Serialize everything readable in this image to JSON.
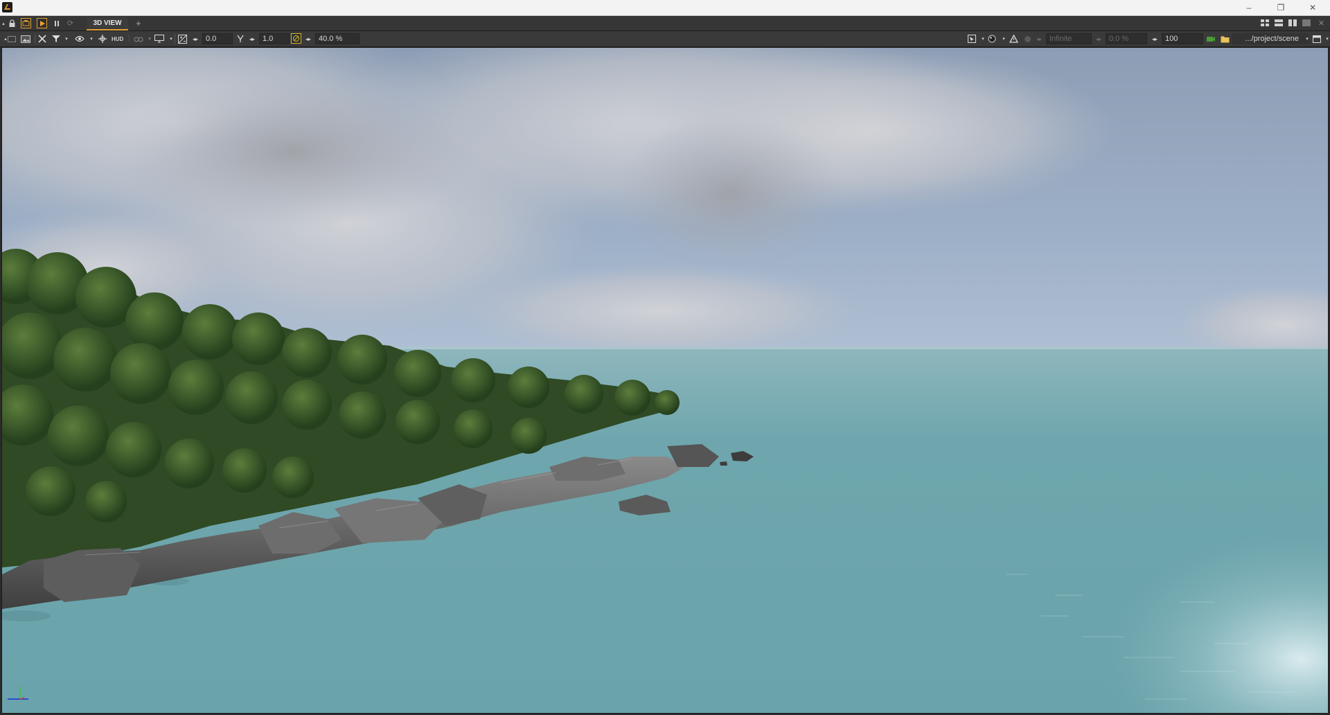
{
  "window": {
    "minimize_glyph": "–",
    "restore_glyph": "❐",
    "close_glyph": "✕"
  },
  "tabs": {
    "active_tab": "3D VIEW",
    "add_tab": "+"
  },
  "toolbar": {
    "hud_label": "HUD",
    "exposure_value": "0.0",
    "gamma_value": "1.0",
    "percentage_value": "40.0 %",
    "range_value": "Infinite",
    "offset_percent": "0.0 %",
    "quality_value": "100",
    "project_path": ".../project/scene"
  },
  "icons": {
    "app": "app-logo-icon",
    "lock": "lock-icon",
    "play": "play-icon",
    "pause": "pause-icon",
    "refresh": "refresh-icon",
    "eye": "eye-icon",
    "filter": "filter-icon",
    "monitor": "monitor-icon",
    "folder": "folder-icon"
  },
  "colors": {
    "accent": "#e0a030",
    "titlebar": "#f3f3f3",
    "toolbar": "#3a3a3a",
    "tabrow": "#363636"
  }
}
